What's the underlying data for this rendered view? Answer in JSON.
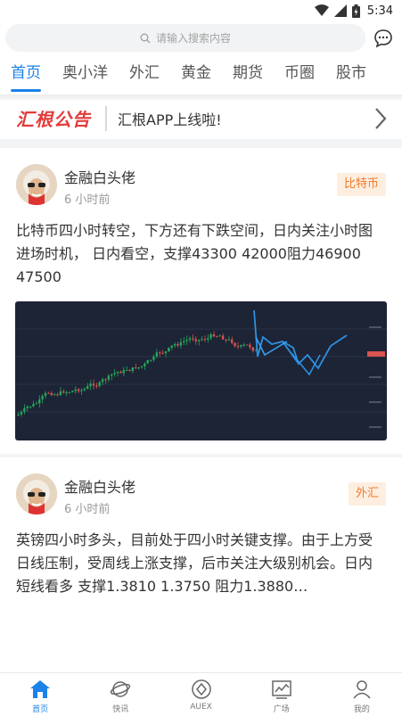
{
  "status_bar": {
    "time": "5:34"
  },
  "search": {
    "placeholder": "请输入搜索内容"
  },
  "tabs": [
    {
      "label": "首页",
      "active": true
    },
    {
      "label": "奥小洋",
      "active": false
    },
    {
      "label": "外汇",
      "active": false
    },
    {
      "label": "黄金",
      "active": false
    },
    {
      "label": "期货",
      "active": false
    },
    {
      "label": "币圈",
      "active": false
    },
    {
      "label": "股市",
      "active": false
    }
  ],
  "announcement": {
    "logo": "汇根公告",
    "text": "汇根APP上线啦!"
  },
  "posts": [
    {
      "author": "金融白头佬",
      "time": "6 小时前",
      "tag": "比特币",
      "text": "比特币四小时转空，下方还有下跌空间，日内关注小时图进场时机， 日内看空，支撑43300 42000阻力46900 47500"
    },
    {
      "author": "金融白头佬",
      "time": "6 小时前",
      "tag": "外汇",
      "text": "英镑四小时多头，目前处于四小时关键支撑。由于上方受日线压制，受周线上涨支撑，后市关注大级别机会。日内短线看多 支撑1.3810 1.3750 阻力1.3880…"
    }
  ],
  "bottom_nav": [
    {
      "label": "首页",
      "icon": "home-icon",
      "active": true
    },
    {
      "label": "快讯",
      "icon": "planet-icon",
      "active": false
    },
    {
      "label": "AUEX",
      "icon": "auex-icon",
      "active": false
    },
    {
      "label": "广场",
      "icon": "chart-icon",
      "active": false
    },
    {
      "label": "我的",
      "icon": "user-icon",
      "active": false
    }
  ],
  "colors": {
    "accent": "#1a82e8",
    "announce_red": "#e23b3b",
    "tag_orange": "#ee7a2c",
    "tag_bg": "#fdeee0",
    "chart_bg": "#1c2435"
  }
}
